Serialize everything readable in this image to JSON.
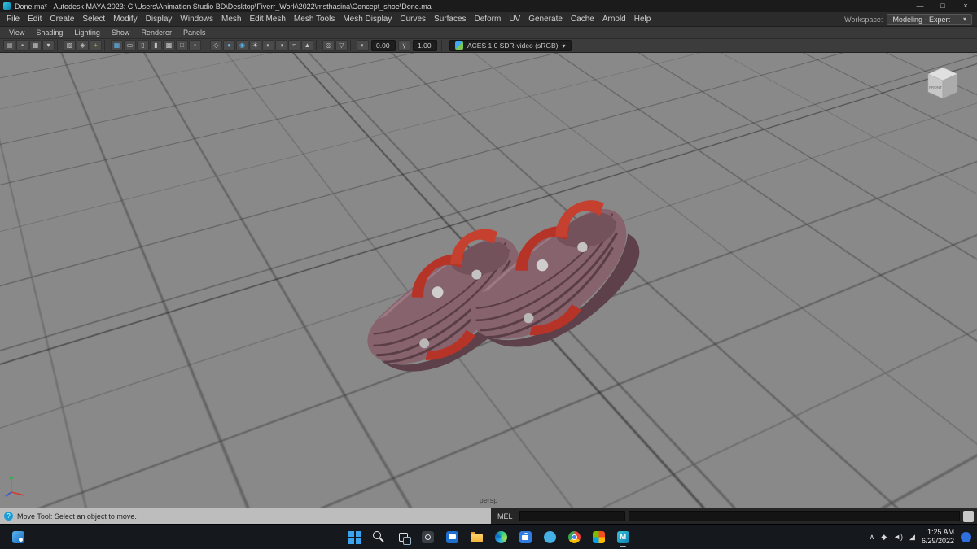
{
  "window": {
    "title": "Done.ma* - Autodesk MAYA 2023: C:\\Users\\Animation Studio BD\\Desktop\\Fiverr_Work\\2022\\msthasina\\Concept_shoe\\Done.ma"
  },
  "icons": {
    "minimize_glyph": "—",
    "maximize_glyph": "□",
    "close_glyph": "×",
    "caret_glyph": "▾",
    "help_glyph": "?"
  },
  "menubar": {
    "items": [
      "File",
      "Edit",
      "Create",
      "Select",
      "Modify",
      "Display",
      "Windows",
      "Mesh",
      "Edit Mesh",
      "Mesh Tools",
      "Mesh Display",
      "Curves",
      "Surfaces",
      "Deform",
      "UV",
      "Generate",
      "Cache",
      "Arnold",
      "Help"
    ],
    "workspace_label": "Workspace:",
    "workspace_value": "Modeling - Expert"
  },
  "panel_menubar": {
    "items": [
      "View",
      "Shading",
      "Lighting",
      "Show",
      "Renderer",
      "Panels"
    ]
  },
  "panel_toolbar": {
    "icons": [
      {
        "name": "camera-select-icon",
        "glyph": "▤"
      },
      {
        "name": "lock-camera-icon",
        "glyph": "▪"
      },
      {
        "name": "camera-attributes-icon",
        "glyph": "▦"
      },
      {
        "name": "bookmarks-icon",
        "glyph": "▾"
      },
      {
        "sep": true
      },
      {
        "name": "image-plane-icon",
        "glyph": "▧"
      },
      {
        "name": "pan-zoom-icon",
        "glyph": "◈"
      },
      {
        "name": "grease-pencil-icon",
        "glyph": "+",
        "fg": "#7ac043"
      },
      {
        "sep": true
      },
      {
        "name": "grid-toggle-icon",
        "glyph": "▦",
        "fg": "#5ab1e8"
      },
      {
        "name": "film-gate-icon",
        "glyph": "▭"
      },
      {
        "name": "resolution-gate-icon",
        "glyph": "▯"
      },
      {
        "name": "gate-mask-icon",
        "glyph": "▮"
      },
      {
        "name": "field-chart-icon",
        "glyph": "▩"
      },
      {
        "name": "safe-action-icon",
        "glyph": "□"
      },
      {
        "name": "safe-title-icon",
        "glyph": "▫"
      },
      {
        "sep": true
      },
      {
        "name": "wireframe-icon",
        "glyph": "◇"
      },
      {
        "name": "smooth-shade-icon",
        "glyph": "●",
        "fg": "#5ab1e8"
      },
      {
        "name": "textured-icon",
        "glyph": "◉",
        "fg": "#5ab1e8"
      },
      {
        "name": "use-all-lights-icon",
        "glyph": "☀"
      },
      {
        "name": "shadows-icon",
        "glyph": "◐"
      },
      {
        "name": "occlusion-icon",
        "glyph": "◑"
      },
      {
        "name": "motion-blur-icon",
        "glyph": "≈"
      },
      {
        "name": "anti-aliasing-icon",
        "glyph": "▲"
      },
      {
        "sep": true
      },
      {
        "name": "isolate-select-icon",
        "glyph": "◎"
      },
      {
        "name": "x-ray-icon",
        "glyph": "▽"
      },
      {
        "sep": true
      }
    ],
    "exposure": "0.00",
    "gamma": "1.00",
    "colorspace": "ACES 1.0 SDR-video (sRGB)"
  },
  "viewport": {
    "camera_label": "persp",
    "viewcube_label": "FRONT"
  },
  "helpline": {
    "text": "Move Tool: Select an object to move."
  },
  "command_line": {
    "label": "MEL"
  },
  "taskbar": {
    "icons": [
      {
        "name": "start",
        "type": "start"
      },
      {
        "name": "search",
        "type": "search"
      },
      {
        "name": "task-view",
        "type": "taskview"
      },
      {
        "name": "settings",
        "type": "settings"
      },
      {
        "name": "mail",
        "type": "mail"
      },
      {
        "name": "file-explorer",
        "type": "folder"
      },
      {
        "name": "edge",
        "type": "edge"
      },
      {
        "name": "store",
        "type": "store"
      },
      {
        "name": "skype",
        "type": "skype"
      },
      {
        "name": "chrome",
        "type": "chrome"
      },
      {
        "name": "photos",
        "type": "photos"
      },
      {
        "name": "maya",
        "type": "maya",
        "active": true
      }
    ],
    "tray": [
      {
        "name": "hidden-icons-chevron-icon",
        "glyph": "∧"
      },
      {
        "name": "tray-app-icon",
        "glyph": "◆"
      },
      {
        "name": "volume-icon",
        "glyph": "◄)"
      },
      {
        "name": "network-icon",
        "glyph": "◢"
      }
    ],
    "time": "1:25 AM",
    "date": "6/29/2022"
  }
}
